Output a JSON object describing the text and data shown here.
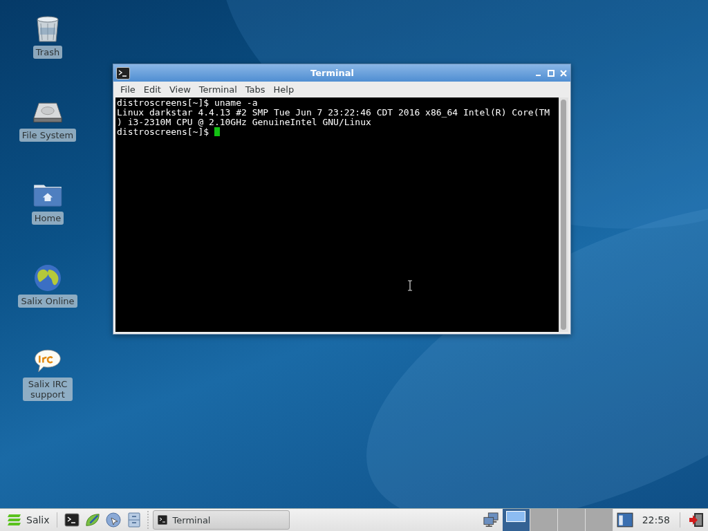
{
  "desktop_icons": [
    {
      "label": "Trash",
      "kind": "trash"
    },
    {
      "label": "File System",
      "kind": "drive"
    },
    {
      "label": "Home",
      "kind": "home"
    },
    {
      "label": "Salix Online",
      "kind": "globe"
    },
    {
      "label": "Salix IRC support",
      "kind": "irc"
    }
  ],
  "window": {
    "title": "Terminal",
    "menu": [
      "File",
      "Edit",
      "View",
      "Terminal",
      "Tabs",
      "Help"
    ],
    "lines": [
      "distroscreens[~]$ uname -a",
      "Linux darkstar 4.4.13 #2 SMP Tue Jun 7 23:22:46 CDT 2016 x86_64 Intel(R) Core(TM",
      ") i3-2310M CPU @ 2.10GHz GenuineIntel GNU/Linux",
      "distroscreens[~]$ "
    ],
    "cursor": true
  },
  "taskbar": {
    "menu_label": "Salix",
    "launchers": [
      {
        "kind": "terminal"
      },
      {
        "kind": "editor"
      },
      {
        "kind": "browser"
      },
      {
        "kind": "files"
      }
    ],
    "tasks": [
      {
        "label": "Terminal"
      }
    ],
    "workspaces": [
      {
        "selected": true
      },
      {
        "selected": false
      },
      {
        "selected": false
      },
      {
        "selected": false
      }
    ],
    "clock": "22:58"
  }
}
